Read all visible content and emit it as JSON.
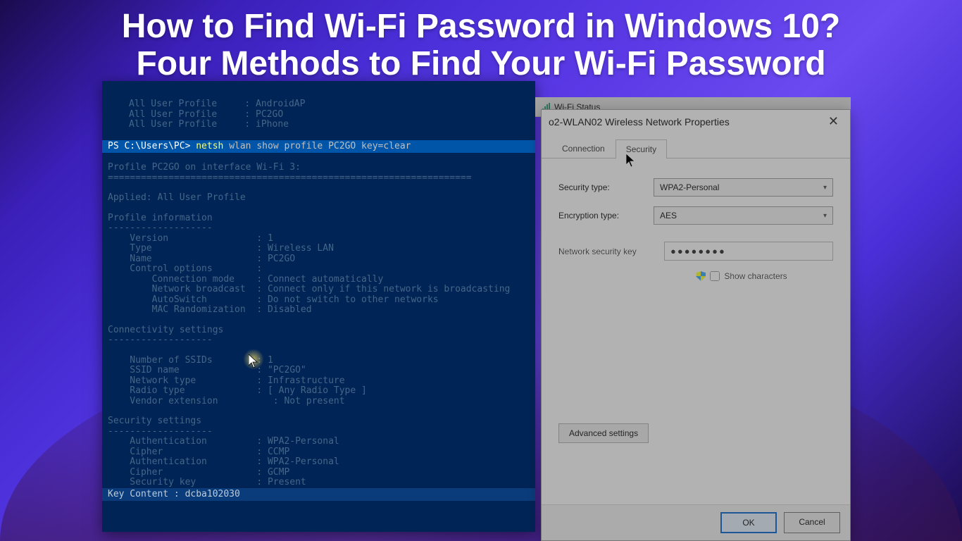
{
  "title": {
    "line1": "How to Find Wi-Fi Password in Windows 10?",
    "line2": "Four Methods to Find Your Wi-Fi Password"
  },
  "powershell": {
    "header_profiles": [
      "All User Profile     : AndroidAP",
      "All User Profile     : PC2GO",
      "All User Profile     : iPhone"
    ],
    "prompt": "PS C:\\Users\\PC>",
    "cmd": "netsh",
    "cmd_args": "wlan show profile PC2GO key=clear",
    "profile_header": "Profile PC2GO on interface Wi-Fi 3:",
    "divider": "==================================================================",
    "applied": "Applied: All User Profile",
    "section_profile": "Profile information",
    "section_conn": "Connectivity settings",
    "section_sec": "Security settings",
    "dash": "-------------------",
    "profile_info": [
      "    Version                : 1",
      "    Type                   : Wireless LAN",
      "    Name                   : PC2GO",
      "    Control options        :",
      "        Connection mode    : Connect automatically",
      "        Network broadcast  : Connect only if this network is broadcasting",
      "        AutoSwitch         : Do not switch to other networks",
      "        MAC Randomization  : Disabled"
    ],
    "conn_info": [
      "    Number of SSIDs        : 1",
      "    SSID name              : \"PC2GO\"",
      "    Network type           : Infrastructure",
      "    Radio type             : [ Any Radio Type ]",
      "    Vendor extension          : Not present"
    ],
    "sec_info": [
      "    Authentication         : WPA2-Personal",
      "    Cipher                 : CCMP",
      "    Authentication         : WPA2-Personal",
      "    Cipher                 : GCMP",
      "    Security key           : Present"
    ],
    "key_line": "    Key Content            : dcba102030"
  },
  "wifi_status": {
    "label": "Wi-Fi Status"
  },
  "dialog": {
    "title": "o2-WLAN02 Wireless Network Properties",
    "tabs": {
      "connection": "Connection",
      "security": "Security"
    },
    "security_type_label": "Security type:",
    "security_type_value": "WPA2-Personal",
    "encryption_label": "Encryption type:",
    "encryption_value": "AES",
    "key_label": "Network security key",
    "key_value": "●●●●●●●●",
    "show_chars": "Show characters",
    "advanced": "Advanced settings",
    "ok": "OK",
    "cancel": "Cancel"
  }
}
